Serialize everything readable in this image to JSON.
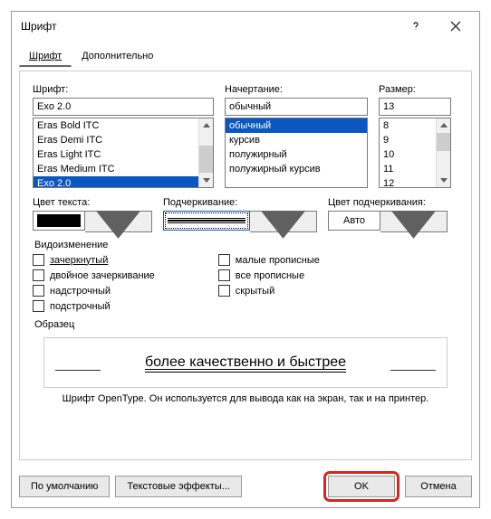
{
  "window": {
    "title": "Шрифт"
  },
  "tabs": {
    "font": "Шрифт",
    "advanced": "Дополнительно"
  },
  "labels": {
    "font": "Шрифт:",
    "style": "Начертание:",
    "size": "Размер:",
    "fontColor": "Цвет текста:",
    "underline": "Подчеркивание:",
    "underlineColor": "Цвет подчеркивания:"
  },
  "font": {
    "value": "Exo 2.0",
    "items": [
      "Eras Bold ITC",
      "Eras Demi ITC",
      "Eras Light ITC",
      "Eras Medium ITC",
      "Exo 2.0"
    ]
  },
  "style": {
    "value": "обычный",
    "items": [
      "обычный",
      "курсив",
      "полужирный",
      "полужирный курсив"
    ]
  },
  "size": {
    "value": "13",
    "items": [
      "8",
      "9",
      "10",
      "11",
      "12"
    ]
  },
  "underlineColor": {
    "value": "Авто"
  },
  "effects": {
    "legend": "Видоизменение",
    "left": [
      "зачеркнутый",
      "двойное зачеркивание",
      "надстрочный",
      "подстрочный"
    ],
    "right": [
      "малые прописные",
      "все прописные",
      "скрытый"
    ]
  },
  "sample": {
    "legend": "Образец",
    "text": "более качественно и быстрее"
  },
  "info": "Шрифт OpenType. Он используется для вывода как на экран, так и на принтер.",
  "buttons": {
    "default": "По умолчанию",
    "textEffects": "Текстовые эффекты...",
    "ok": "OK",
    "cancel": "Отмена"
  }
}
